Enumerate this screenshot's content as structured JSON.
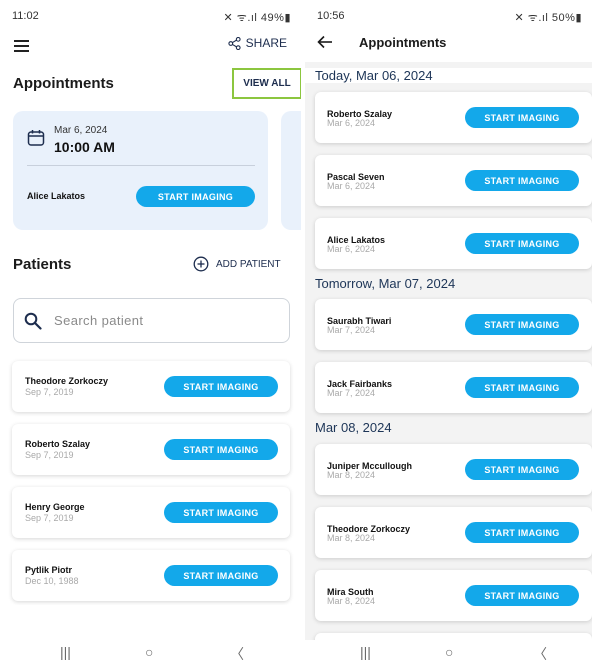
{
  "left": {
    "status": {
      "time": "11:02",
      "sys": "✕ ᯤ.ıl 49%▮"
    },
    "share_label": "SHARE",
    "appointments_title": "Appointments",
    "view_all_label": "VIEW ALL",
    "appointment_card": {
      "date": "Mar 6, 2024",
      "time": "10:00 AM",
      "patient": "Alice Lakatos",
      "button": "START IMAGING"
    },
    "patients_title": "Patients",
    "add_patient_label": "ADD PATIENT",
    "search_placeholder": "Search patient",
    "patients": [
      {
        "name": "Theodore Zorkoczy",
        "date": "Sep 7, 2019",
        "button": "START IMAGING"
      },
      {
        "name": "Roberto Szalay",
        "date": "Sep 7, 2019",
        "button": "START IMAGING"
      },
      {
        "name": "Henry George",
        "date": "Sep 7, 2019",
        "button": "START IMAGING"
      },
      {
        "name": "Pytlik Piotr",
        "date": "Dec 10, 1988",
        "button": "START IMAGING"
      }
    ]
  },
  "right": {
    "status": {
      "time": "10:56",
      "sys": "✕ ᯤ.ıl 50%▮"
    },
    "title": "Appointments",
    "groups": [
      {
        "label": "Today, Mar 06, 2024",
        "items": [
          {
            "name": "Roberto Szalay",
            "date": "Mar 6, 2024",
            "button": "START IMAGING"
          },
          {
            "name": "Pascal Seven",
            "date": "Mar 6, 2024",
            "button": "START IMAGING"
          },
          {
            "name": "Alice Lakatos",
            "date": "Mar 6, 2024",
            "button": "START IMAGING"
          }
        ]
      },
      {
        "label": "Tomorrow, Mar 07, 2024",
        "items": [
          {
            "name": "Saurabh Tiwari",
            "date": "Mar 7, 2024",
            "button": "START IMAGING"
          },
          {
            "name": "Jack Fairbanks",
            "date": "Mar 7, 2024",
            "button": "START IMAGING"
          }
        ]
      },
      {
        "label": "Mar 08, 2024",
        "items": [
          {
            "name": "Juniper Mccullough",
            "date": "Mar 8, 2024",
            "button": "START IMAGING"
          },
          {
            "name": "Theodore Zorkoczy",
            "date": "Mar 8, 2024",
            "button": "START IMAGING"
          },
          {
            "name": "Mira South",
            "date": "Mar 8, 2024",
            "button": "START IMAGING"
          }
        ]
      }
    ]
  },
  "nav": {
    "recents": "|||",
    "home": "○",
    "back": "〈"
  },
  "colors": {
    "accent": "#13a8ea",
    "highlight": "#8cc63f",
    "card_bg": "#e9f1fb",
    "navy": "#1d3557"
  },
  "icons": [
    "menu-icon",
    "share-icon",
    "calendar-icon",
    "add-circle-icon",
    "search-icon",
    "back-arrow-icon"
  ]
}
